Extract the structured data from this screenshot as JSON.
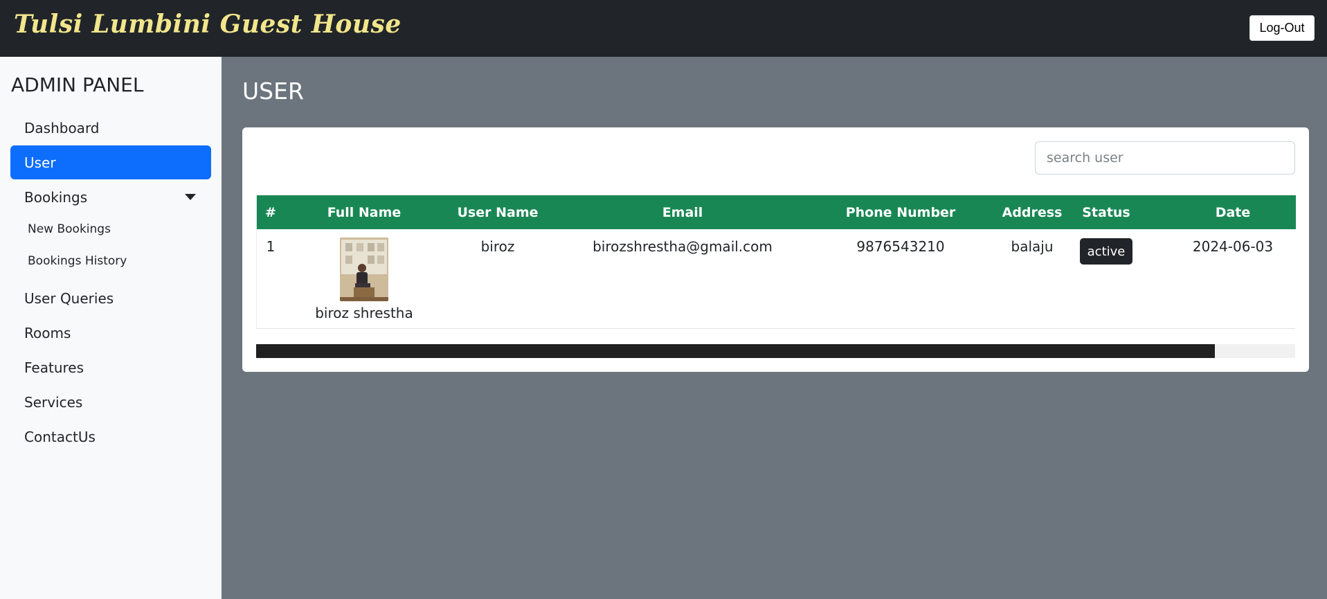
{
  "header": {
    "brand": "Tulsi Lumbini Guest House",
    "logout_label": "Log-Out"
  },
  "sidebar": {
    "title": "ADMIN PANEL",
    "items": [
      {
        "label": "Dashboard"
      },
      {
        "label": "User",
        "active": true
      },
      {
        "label": "Bookings",
        "icon": "caret-down-icon"
      },
      {
        "label": "User Queries"
      },
      {
        "label": "Rooms"
      },
      {
        "label": "Features"
      },
      {
        "label": "Services"
      },
      {
        "label": "ContactUs"
      }
    ],
    "bookings_sub": [
      {
        "label": "New Bookings"
      },
      {
        "label": "Bookings History"
      }
    ]
  },
  "main": {
    "title": "USER",
    "search": {
      "placeholder": "search user",
      "value": ""
    },
    "table": {
      "columns": [
        "#",
        "Full Name",
        "User Name",
        "Email",
        "Phone Number",
        "Address",
        "Status",
        "Date"
      ],
      "rows": [
        {
          "index": "1",
          "full_name": "biroz shrestha",
          "user_name": "biroz",
          "email": "birozshrestha@gmail.com",
          "phone": "9876543210",
          "address": "balaju",
          "status": "active",
          "date": "2024-06-03"
        }
      ]
    },
    "scroll_fraction_visible": 0.923
  },
  "colors": {
    "topbar": "#212529",
    "brand_text": "#f2e68c",
    "active_nav": "#0d6efd",
    "table_header": "#198754",
    "content_bg": "#6c757d"
  }
}
